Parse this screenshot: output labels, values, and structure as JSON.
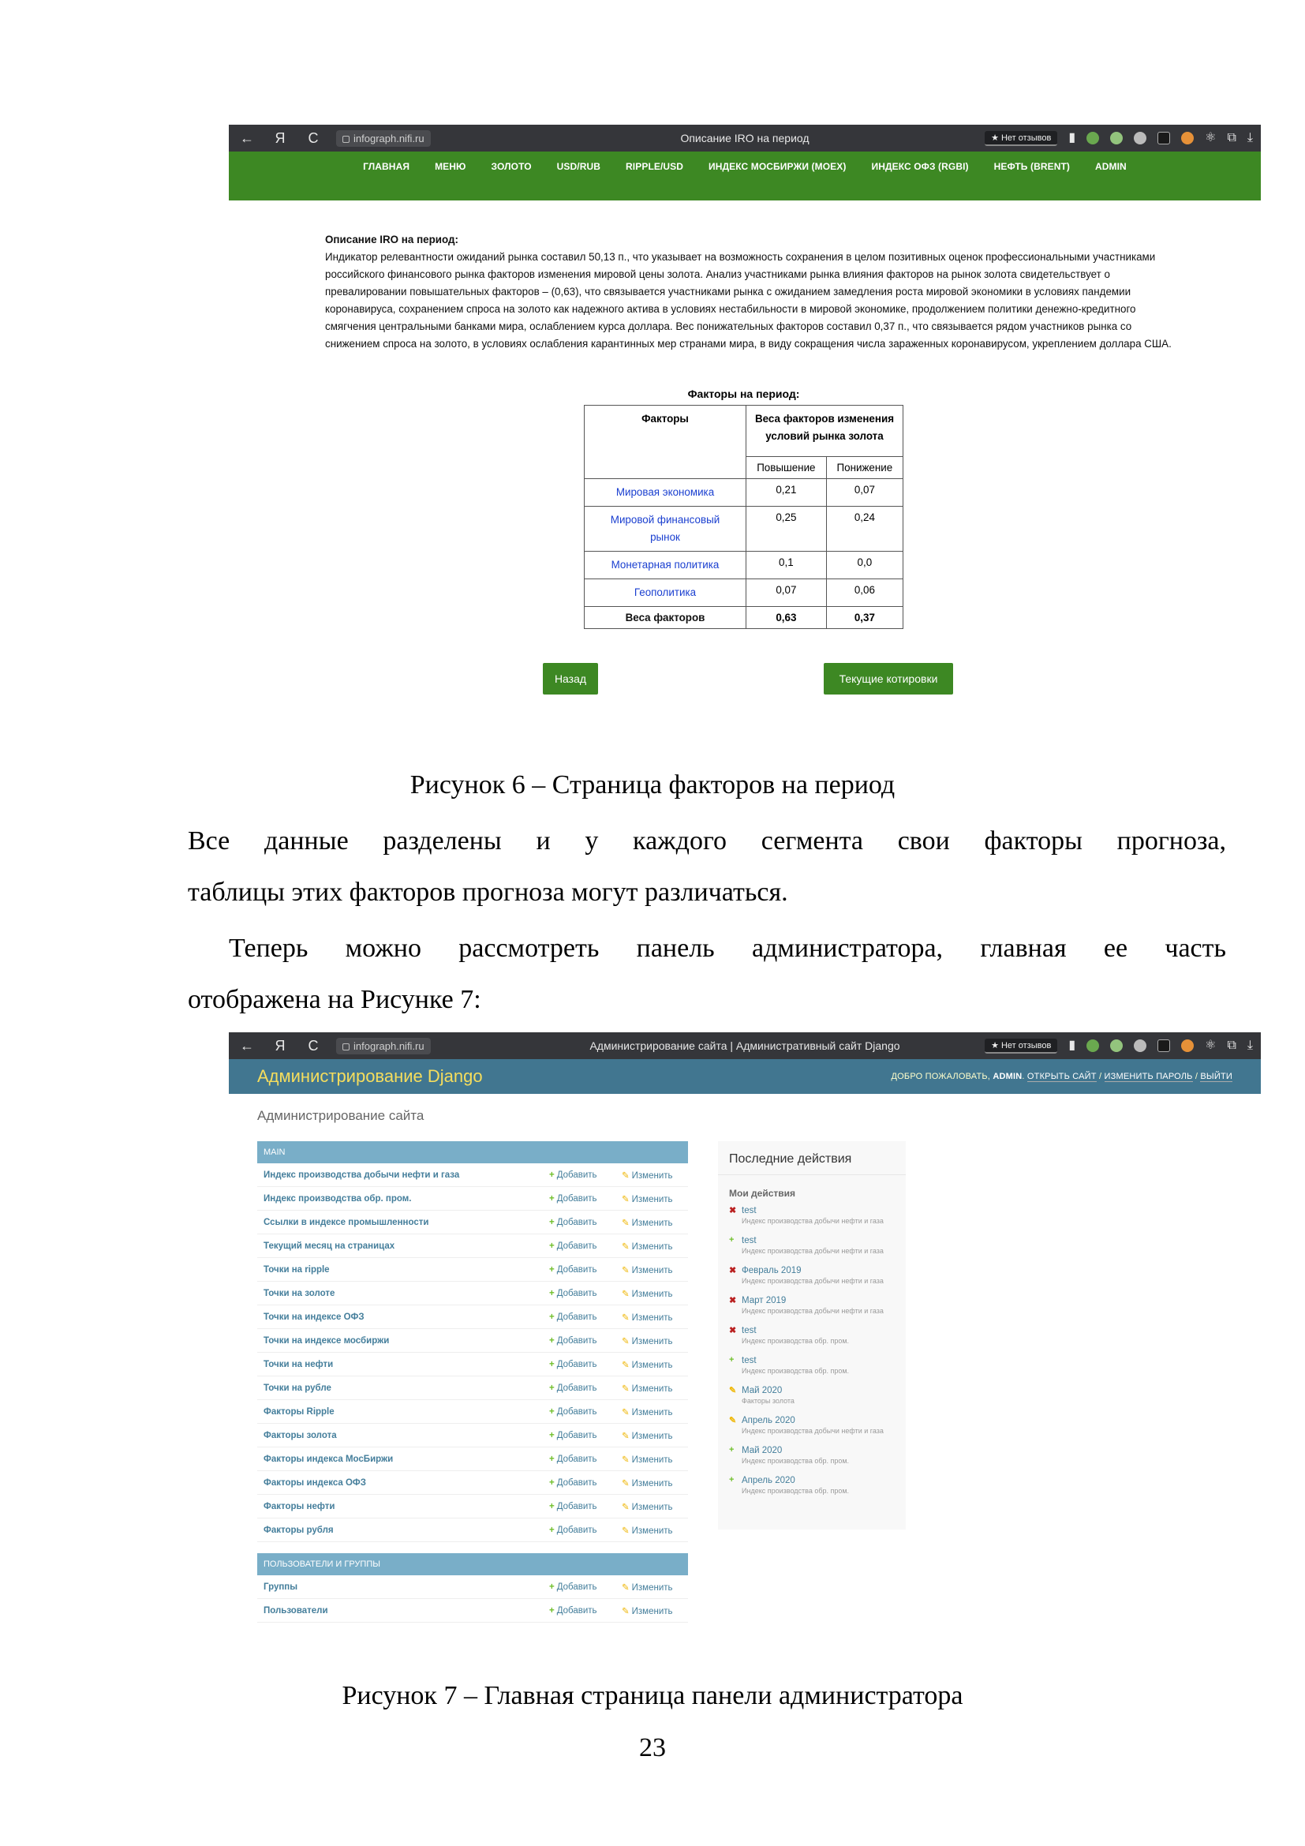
{
  "figure6": {
    "browser": {
      "nav_icons": [
        "←",
        "Я",
        "C"
      ],
      "url": "infograph.nifi.ru",
      "tab_title": "Описание IRO на период",
      "reviews": "★ Нет отзывов"
    },
    "nav": [
      "ГЛАВНАЯ",
      "МЕНЮ",
      "ЗОЛОТО",
      "USD/RUB",
      "RIPPLE/USD",
      "ИНДЕКС МОСБИРЖИ (MOEX)",
      "ИНДЕКС ОФЗ (RGBI)",
      "НЕФТЬ (BRENT)",
      "ADMIN"
    ],
    "iro_title": "Описание IRO на период:",
    "iro_text": "Индикатор релевантности ожиданий рынка составил 50,13 п., что указывает на возможность сохранения в целом позитивных оценок профессиональными участниками российского финансового рынка факторов изменения мировой цены золота. Анализ участниками рынка влияния факторов на рынок золота свидетельствует о превалировании повышательных факторов – (0,63), что связывается участниками рынка с ожиданием замедления роста мировой экономики в условиях пандемии коронавируса, сохранением спроса на золото как надежного актива в условиях нестабильности в мировой экономике, продолжением политики денежно-кредитного смягчения центральными банками мира, ослаблением курса доллара. Вес понижательных факторов составил 0,37 п., что связывается рядом участников рынка со снижением спроса на золото, в условиях ослабления карантинных мер странами мира, в виду сокращения числа зараженных коронавирусом, укреплением доллара США.",
    "table": {
      "caption": "Факторы на период:",
      "col_factors": "Факторы",
      "col_weights": "Веса факторов изменения условий рынка золота",
      "col_up": "Повышение",
      "col_down": "Понижение",
      "rows": [
        {
          "name": "Мировая экономика",
          "up": "0,21",
          "down": "0,07"
        },
        {
          "name": "Мировой финансовый рынок",
          "up": "0,25",
          "down": "0,24"
        },
        {
          "name": "Монетарная политика",
          "up": "0,1",
          "down": "0,0"
        },
        {
          "name": "Геополитика",
          "up": "0,07",
          "down": "0,06"
        }
      ],
      "total": {
        "name": "Веса факторов",
        "up": "0,63",
        "down": "0,37"
      }
    },
    "btn_back": "Назад",
    "btn_quotes": "Текущие котировки"
  },
  "caption6": "Рисунок 6 – Страница факторов на период",
  "para1_line1": "Все данные разделены и у каждого сегмента свои факторы прогноза,",
  "para1_line2": "таблицы этих факторов прогноза могут различаться.",
  "para2_line1": "Теперь можно рассмотреть панель администратора, главная ее часть",
  "para2_line2": "отображена на Рисунке 7:",
  "figure7": {
    "browser": {
      "nav_icons": [
        "←",
        "Я",
        "C"
      ],
      "url": "infograph.nifi.ru",
      "tab_title": "Администрирование сайта | Административный сайт Django",
      "reviews": "★ Нет отзывов"
    },
    "brand": "Администрирование Django",
    "tools_welcome": "ДОБРО ПОЖАЛОВАТЬ,",
    "tools_user": "ADMIN",
    "tools_view_site": "ОТКРЫТЬ САЙТ",
    "tools_change_pw": "ИЗМЕНИТЬ ПАРОЛЬ",
    "tools_logout": "ВЫЙТИ",
    "site_title": "Администрирование сайта",
    "add_label": "Добавить",
    "change_label": "Изменить",
    "main_module": {
      "caption": "Main",
      "rows": [
        "Индекс производства добычи нефти и газа",
        "Индекс производства обр. пром.",
        "Ссылки в индексе промышленности",
        "Текущий месяц на страницах",
        "Точки на ripple",
        "Точки на золоте",
        "Точки на индексе ОФЗ",
        "Точки на индексе мосбиржи",
        "Точки на нефти",
        "Точки на рубле",
        "Факторы Ripple",
        "Факторы золота",
        "Факторы индекса МосБиржи",
        "Факторы индекса ОФЗ",
        "Факторы нефти",
        "Факторы рубля"
      ]
    },
    "auth_module": {
      "caption": "Пользователи и группы",
      "rows": [
        "Группы",
        "Пользователи"
      ]
    },
    "recent": {
      "title": "Последние действия",
      "subtitle": "Мои действия",
      "items": [
        {
          "kind": "del",
          "icon": "✖",
          "name": "test",
          "type": "Индекс производства добычи нефти и газа"
        },
        {
          "kind": "add",
          "icon": "+",
          "name": "test",
          "type": "Индекс производства добычи нефти и газа"
        },
        {
          "kind": "del",
          "icon": "✖",
          "name": "Февраль 2019",
          "type": "Индекс производства добычи нефти и газа"
        },
        {
          "kind": "del",
          "icon": "✖",
          "name": "Март 2019",
          "type": "Индекс производства добычи нефти и газа"
        },
        {
          "kind": "del",
          "icon": "✖",
          "name": "test",
          "type": "Индекс производства обр. пром."
        },
        {
          "kind": "add",
          "icon": "+",
          "name": "test",
          "type": "Индекс производства обр. пром."
        },
        {
          "kind": "chg",
          "icon": "✎",
          "name": "Май 2020",
          "type": "Факторы золота"
        },
        {
          "kind": "chg",
          "icon": "✎",
          "name": "Апрель 2020",
          "type": "Индекс производства добычи нефти и газа"
        },
        {
          "kind": "add",
          "icon": "+",
          "name": "Май 2020",
          "type": "Индекс производства обр. пром."
        },
        {
          "kind": "add",
          "icon": "+",
          "name": "Апрель 2020",
          "type": "Индекс производства обр. пром."
        }
      ]
    }
  },
  "caption7": "Рисунок 7 – Главная страница панели администратора",
  "page_number": "23"
}
